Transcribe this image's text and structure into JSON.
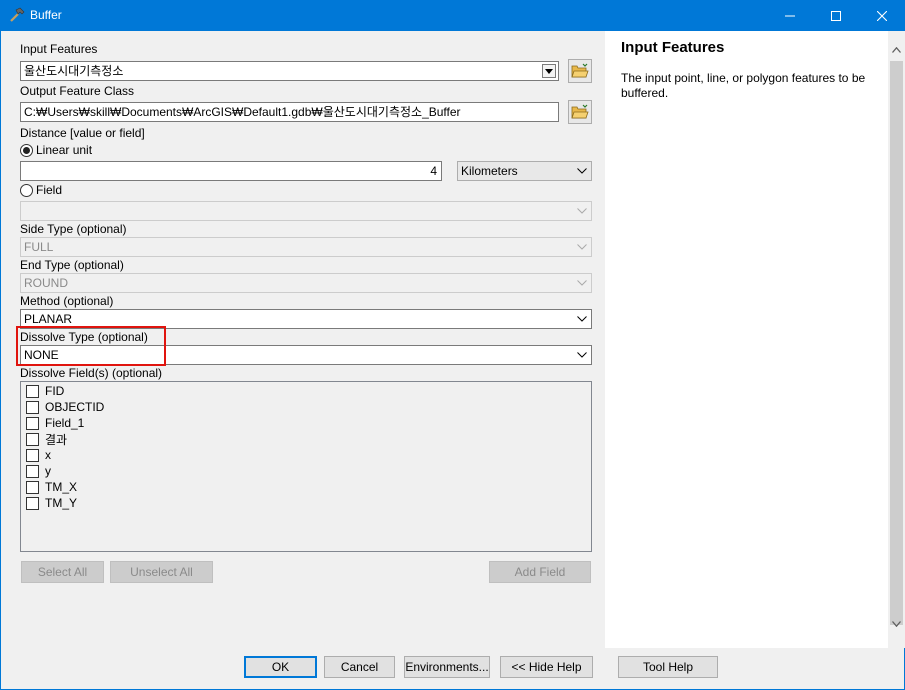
{
  "window": {
    "title": "Buffer",
    "minimize_icon": "minimize-icon",
    "maximize_icon": "maximize-icon",
    "close_icon": "close-icon"
  },
  "form": {
    "input_features": {
      "label": "Input Features",
      "value": "울산도시대기측정소"
    },
    "output_feature_class": {
      "label": "Output Feature Class",
      "value": "C:₩Users₩skill₩Documents₩ArcGIS₩Default1.gdb₩울산도시대기측정소_Buffer"
    },
    "distance": {
      "label": "Distance [value or field]",
      "linear_unit_label": "Linear unit",
      "value": "4",
      "unit": "Kilometers",
      "field_label": "Field",
      "field_value": ""
    },
    "side_type": {
      "label": "Side Type (optional)",
      "value": "FULL"
    },
    "end_type": {
      "label": "End Type (optional)",
      "value": "ROUND"
    },
    "method": {
      "label": "Method (optional)",
      "value": "PLANAR"
    },
    "dissolve_type": {
      "label": "Dissolve Type (optional)",
      "value": "NONE"
    },
    "dissolve_fields": {
      "label": "Dissolve Field(s) (optional)",
      "items": [
        "FID",
        "OBJECTID",
        "Field_1",
        "결과",
        "x",
        "y",
        "TM_X",
        "TM_Y"
      ]
    },
    "select_all": "Select All",
    "unselect_all": "Unselect All",
    "add_field": "Add Field"
  },
  "help": {
    "title": "Input Features",
    "text": "The input point, line, or polygon features to be buffered."
  },
  "buttons": {
    "ok": "OK",
    "cancel": "Cancel",
    "environments": "Environments...",
    "hide_help": "<< Hide Help",
    "tool_help": "Tool Help"
  },
  "colors": {
    "titlebar": "#0078d7",
    "highlight": "#e0140e"
  }
}
